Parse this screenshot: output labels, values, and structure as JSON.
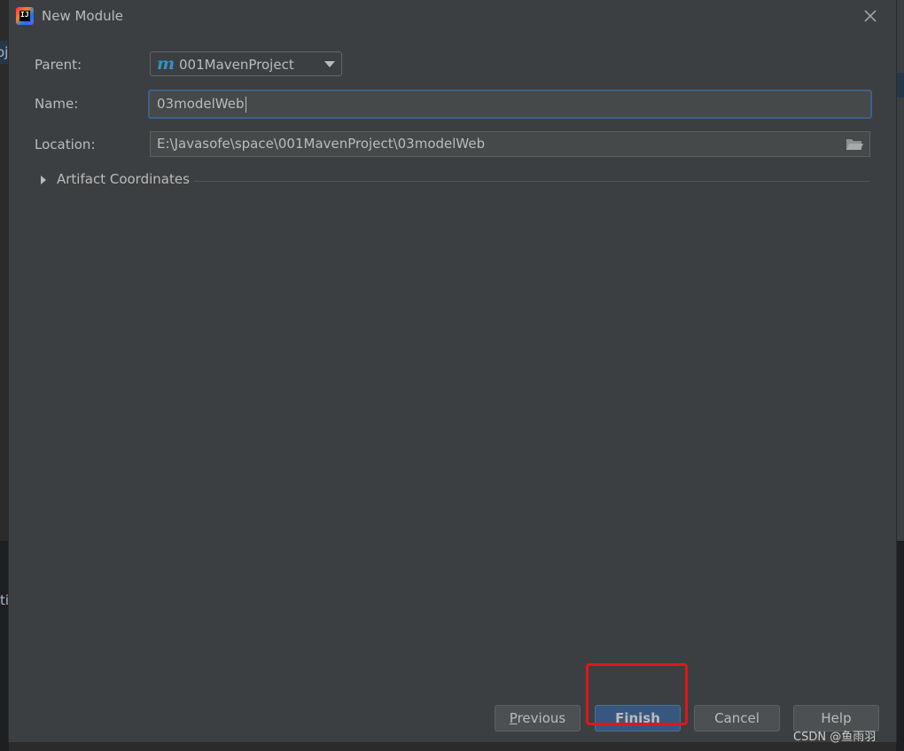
{
  "window": {
    "title": "New Module"
  },
  "form": {
    "parent_label": "Parent:",
    "parent_value": "001MavenProject",
    "parent_icon": "maven-m-icon",
    "name_label": "Name:",
    "name_value": "03modelWeb",
    "location_label": "Location:",
    "location_value": "E:\\Javasofe\\space\\001MavenProject\\03modelWeb"
  },
  "section": {
    "artifact_label": "Artifact Coordinates"
  },
  "buttons": {
    "previous_first": "P",
    "previous_rest": "revious",
    "finish": "Finish",
    "cancel": "Cancel",
    "help": "Help"
  },
  "background": {
    "left_tab_text": "oj",
    "left_lower_text": "ti"
  },
  "watermark": "CSDN @鱼雨羽",
  "colors": {
    "dialog_bg": "#3c3f41",
    "focus_border": "#3d6185",
    "primary_button": "#365880",
    "annotation": "#e0161b"
  }
}
